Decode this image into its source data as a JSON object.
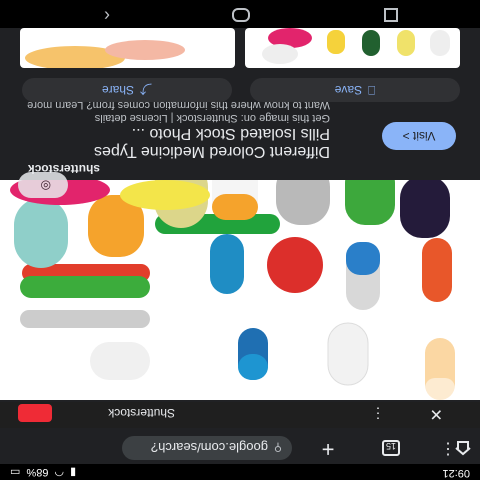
{
  "status": {
    "time": "09:21",
    "battery": "68%",
    "battery_icon": "battery-icon",
    "wifi_icon": "wifi-icon",
    "signal_icon": "signal-icon"
  },
  "browser": {
    "url": "google.com/search?",
    "tab_count": "15"
  },
  "result": {
    "source_name": "Shutterstock",
    "site_badge": "shutterstock",
    "visit_label": "Visit",
    "title_line1": "Different Colored Medicine Types",
    "title_line2": "Pills Isolated Stock Photo ...",
    "license_line1": "Get this image on: Shutterstock | License details",
    "license_line2": "Want to know where this information comes from? Learn more",
    "share_label": "Share",
    "save_label": "Save"
  },
  "colors": {
    "accent": "#8ab4f8",
    "logo_red": "#ef2b36",
    "bg": "#202124"
  }
}
